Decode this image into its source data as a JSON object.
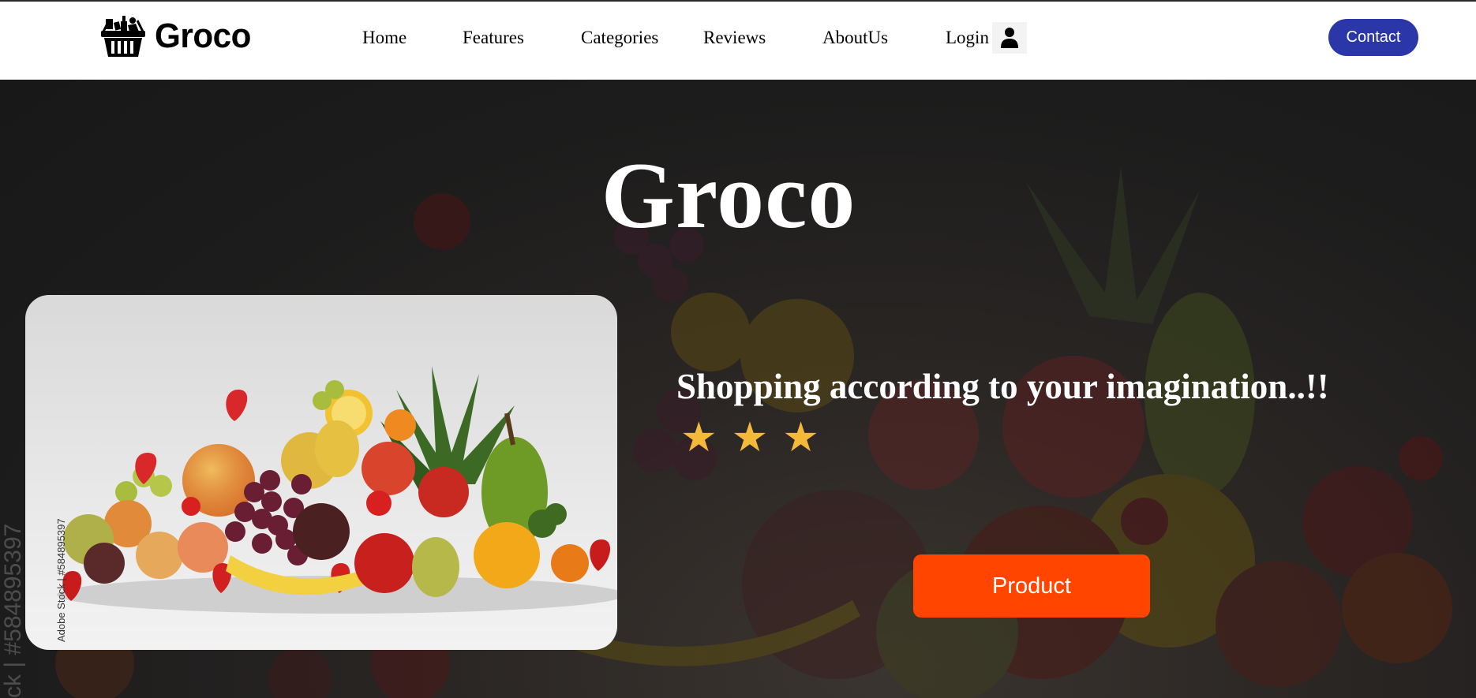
{
  "brand": {
    "name": "Groco",
    "icon": "grocery-basket-icon"
  },
  "nav": {
    "links": [
      {
        "label": "Home"
      },
      {
        "label": "Features"
      },
      {
        "label": "Categories"
      },
      {
        "label": "Reviews"
      },
      {
        "label": "AboutUs"
      }
    ],
    "login": {
      "label": "Login",
      "icon": "user-icon"
    },
    "contact_label": "Contact"
  },
  "hero": {
    "title": "Groco",
    "tagline": "Shopping according to your imagination..!!",
    "rating": {
      "stars": 3,
      "symbol": "★"
    },
    "product_button_label": "Product",
    "card_watermark": "Adobe Stock | #584895397",
    "edge_watermark": "ck | #584895397",
    "card_image": "fruit-arrangement-image"
  },
  "colors": {
    "contact_button": "#2b36a8",
    "product_button": "#ff4500",
    "star": "#f5b93a",
    "hero_background": "#1b1b1b"
  }
}
